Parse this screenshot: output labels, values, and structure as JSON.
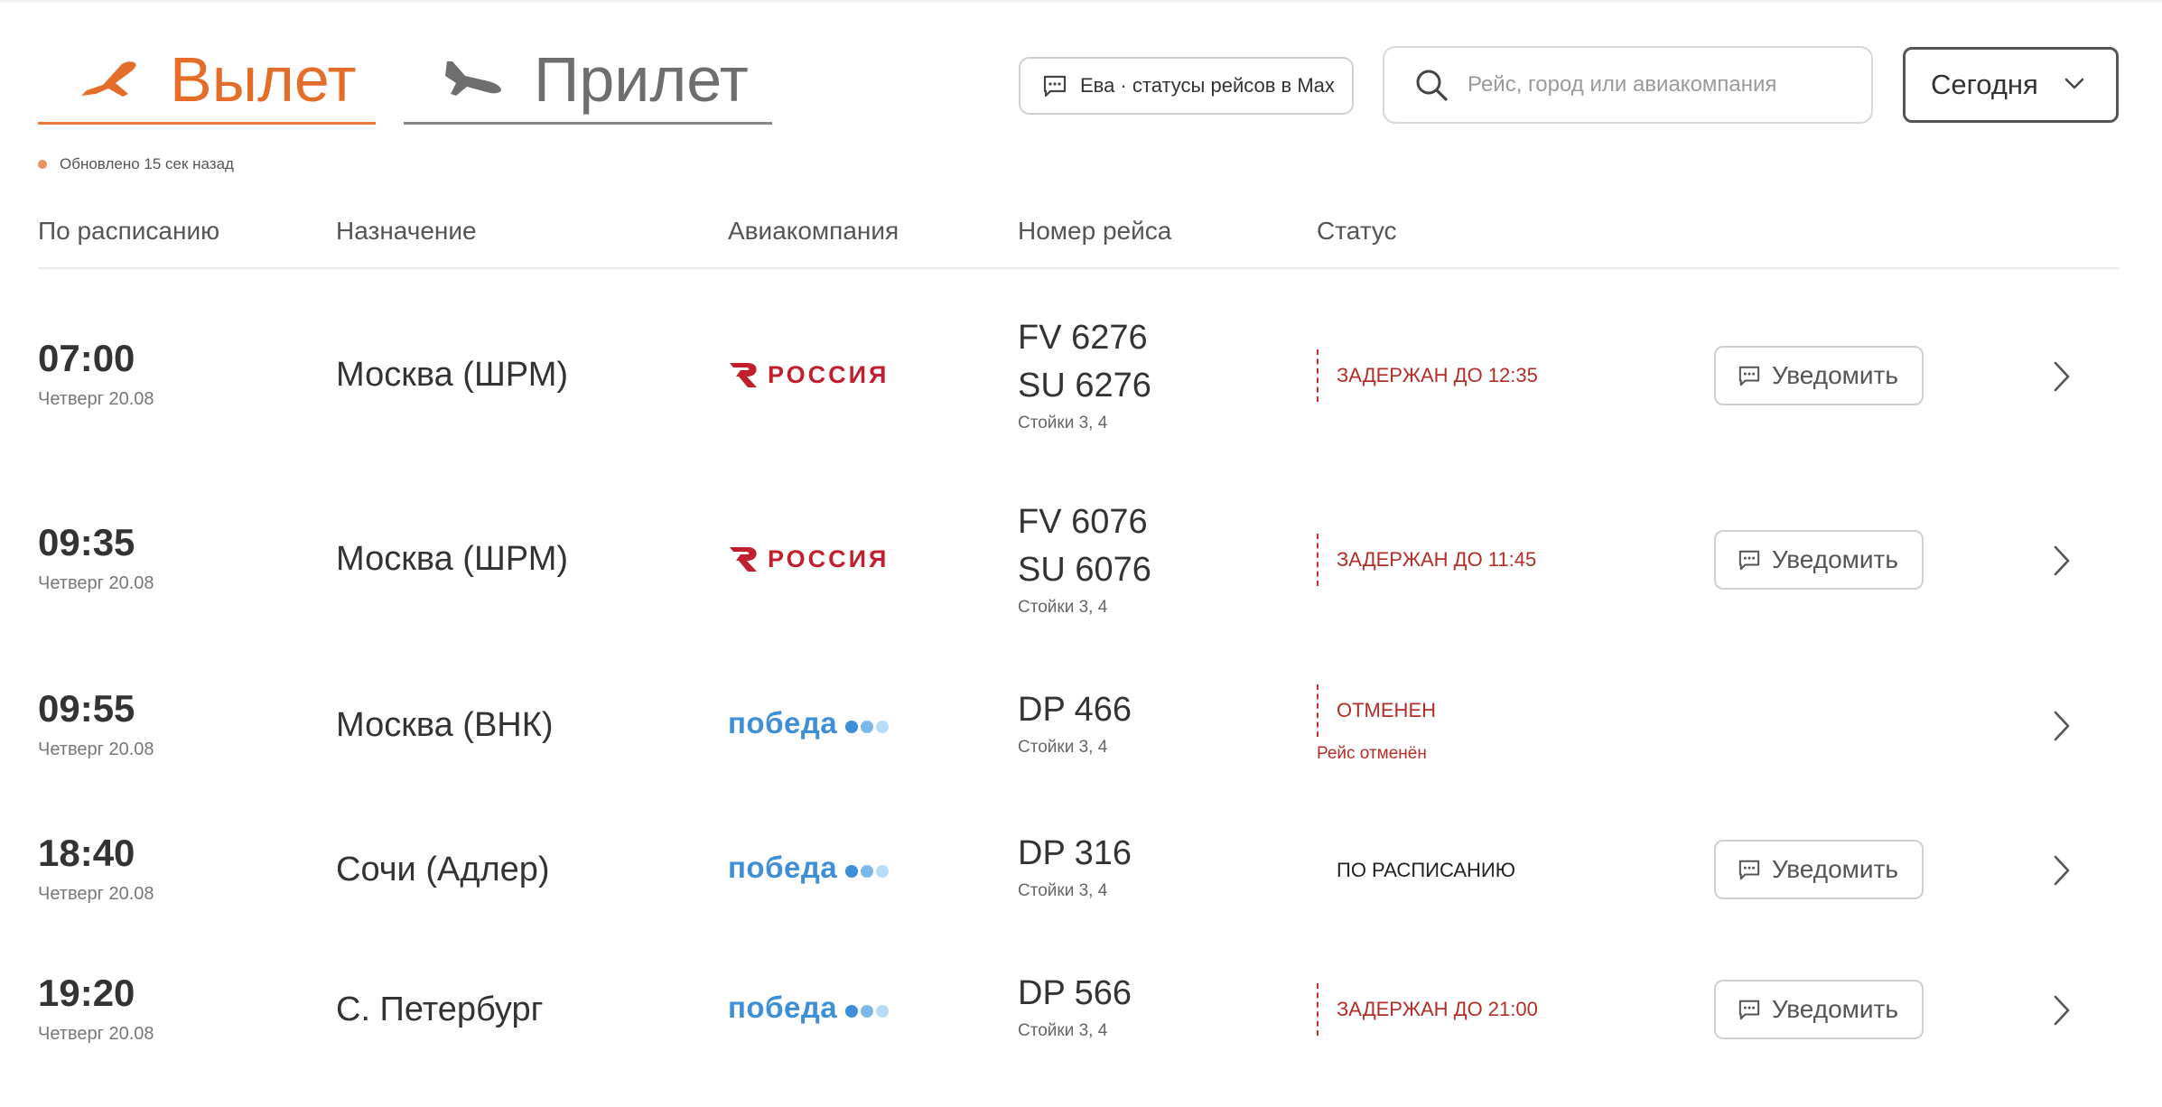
{
  "tabs": [
    {
      "label": "Вылет",
      "active": true,
      "icon": "plane-takeoff-icon"
    },
    {
      "label": "Прилет",
      "active": false,
      "icon": "plane-landing-icon"
    }
  ],
  "eva_button": {
    "label": "Ева · статусы рейсов в Max",
    "icon": "chat-icon"
  },
  "search": {
    "placeholder": "Рейс, город или авиакомпания",
    "icon": "search-icon"
  },
  "date_select": {
    "value": "Сегодня",
    "icon": "chevron-down-icon"
  },
  "updated": {
    "text": "Обновлено 15 сек назад"
  },
  "columns": [
    "По расписанию",
    "Назначение",
    "Авиакомпания",
    "Номер рейса",
    "Статус"
  ],
  "notify_label": "Уведомить",
  "airline_logos": {
    "rossiya": {
      "wordmark": "РОССИЯ",
      "color": "#c21f2e"
    },
    "pobeda": {
      "wordmark": "победа",
      "color": "#3e8fd8",
      "dot_colors": [
        "#3e8fd8",
        "#7db7ea",
        "#b9dbf7"
      ]
    }
  },
  "colors": {
    "accent": "#e46d2a",
    "status_alert": "#b42d26"
  },
  "flights": [
    {
      "time": "07:00",
      "day": "Четверг 20.08",
      "destination": "Москва (ШРМ)",
      "airline": "rossiya",
      "numbers": [
        "FV 6276",
        "SU 6276"
      ],
      "gates": "Стойки 3, 4",
      "status": "ЗАДЕРЖАН ДО 12:35",
      "status_type": "alert",
      "note": "",
      "notify": true
    },
    {
      "time": "09:35",
      "day": "Четверг 20.08",
      "destination": "Москва (ШРМ)",
      "airline": "rossiya",
      "numbers": [
        "FV 6076",
        "SU 6076"
      ],
      "gates": "Стойки 3, 4",
      "status": "ЗАДЕРЖАН ДО 11:45",
      "status_type": "alert",
      "note": "",
      "notify": true
    },
    {
      "time": "09:55",
      "day": "Четверг 20.08",
      "destination": "Москва (ВНК)",
      "airline": "pobeda",
      "numbers": [
        "DP 466"
      ],
      "gates": "Стойки 3, 4",
      "status": "ОТМЕНЕН",
      "status_type": "alert",
      "note": "Рейс отменён",
      "notify": false
    },
    {
      "time": "18:40",
      "day": "Четверг 20.08",
      "destination": "Сочи (Адлер)",
      "airline": "pobeda",
      "numbers": [
        "DP 316"
      ],
      "gates": "Стойки 3, 4",
      "status": "ПО РАСПИСАНИЮ",
      "status_type": "ok",
      "note": "",
      "notify": true
    },
    {
      "time": "19:20",
      "day": "Четверг 20.08",
      "destination": "С. Петербург",
      "airline": "pobeda",
      "numbers": [
        "DP 566"
      ],
      "gates": "Стойки 3, 4",
      "status": "ЗАДЕРЖАН ДО 21:00",
      "status_type": "alert",
      "note": "",
      "notify": true
    }
  ]
}
